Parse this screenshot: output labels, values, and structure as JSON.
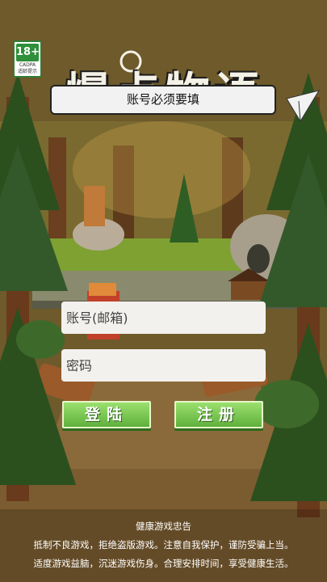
{
  "age_rating": {
    "label": "18+",
    "org": "CADPA",
    "tip": "适龄提示"
  },
  "game_title": "爆点物语",
  "toast": {
    "message": "账号必须要填"
  },
  "login": {
    "account_placeholder": "账号(邮箱)",
    "password_placeholder": "密码",
    "login_label": "登陆",
    "register_label": "注册"
  },
  "health_notice": {
    "title": "健康游戏忠告",
    "line1": "抵制不良游戏，拒绝盗版游戏。注意自我保护，谨防受骗上当。",
    "line2": "适度游戏益脑，沉迷游戏伤身。合理安排时间，享受健康生活。"
  },
  "colors": {
    "button_green": "#5fb03c",
    "forest_dark": "#2f4a1f",
    "path_brown": "#8a6a3a"
  }
}
